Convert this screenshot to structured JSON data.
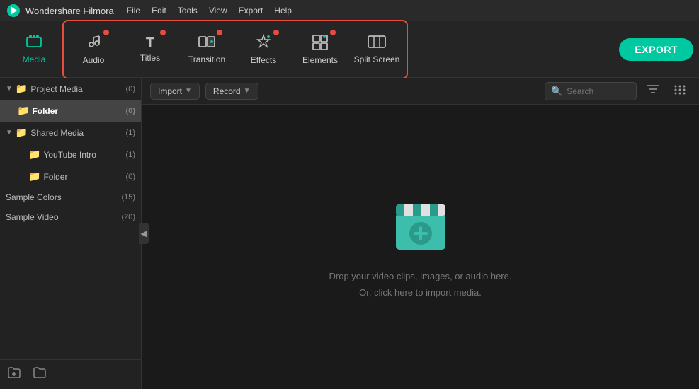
{
  "app": {
    "name": "Wondershare Filmora",
    "icon": "W"
  },
  "menu": {
    "items": [
      "File",
      "Edit",
      "Tools",
      "View",
      "Export",
      "Help"
    ]
  },
  "toolbar": {
    "export_label": "EXPORT",
    "buttons": [
      {
        "id": "media",
        "label": "Media",
        "icon": "🎞",
        "active": true,
        "dot": false
      },
      {
        "id": "audio",
        "label": "Audio",
        "icon": "🎵",
        "active": false,
        "dot": true
      },
      {
        "id": "titles",
        "label": "Titles",
        "icon": "T",
        "active": false,
        "dot": true
      },
      {
        "id": "transition",
        "label": "Transition",
        "icon": "◧",
        "active": false,
        "dot": true
      },
      {
        "id": "effects",
        "label": "Effects",
        "icon": "✦",
        "active": false,
        "dot": true
      },
      {
        "id": "elements",
        "label": "Elements",
        "icon": "⬚",
        "active": false,
        "dot": true
      },
      {
        "id": "split-screen",
        "label": "Split Screen",
        "icon": "⊞",
        "active": false,
        "dot": false
      }
    ]
  },
  "content_toolbar": {
    "import_label": "Import",
    "record_label": "Record",
    "search_placeholder": "Search"
  },
  "sidebar": {
    "sections": [
      {
        "id": "project-media",
        "label": "Project Media",
        "count": "(0)",
        "indent": 0,
        "expanded": true,
        "children": [
          {
            "id": "folder",
            "label": "Folder",
            "count": "(0)",
            "indent": 1,
            "selected": true
          }
        ]
      },
      {
        "id": "shared-media",
        "label": "Shared Media",
        "count": "(1)",
        "indent": 0,
        "expanded": true,
        "children": [
          {
            "id": "youtube-intro",
            "label": "YouTube Intro",
            "count": "(1)",
            "indent": 1,
            "selected": false
          },
          {
            "id": "folder2",
            "label": "Folder",
            "count": "(0)",
            "indent": 1,
            "selected": false
          }
        ]
      },
      {
        "id": "sample-colors",
        "label": "Sample Colors",
        "count": "(15)",
        "indent": 0,
        "expanded": false,
        "children": []
      },
      {
        "id": "sample-video",
        "label": "Sample Video",
        "count": "(20)",
        "indent": 0,
        "expanded": false,
        "children": []
      }
    ],
    "footer": {
      "add_folder_icon": "📁",
      "new_folder_icon": "📂"
    }
  },
  "drop_zone": {
    "line1": "Drop your video clips, images, or audio here.",
    "line2": "Or, click here to import media."
  },
  "colors": {
    "accent": "#00c8a0",
    "danger": "#e74c3c",
    "bg_dark": "#1a1a1a",
    "sidebar_bg": "#222222",
    "toolbar_bg": "#252525"
  }
}
